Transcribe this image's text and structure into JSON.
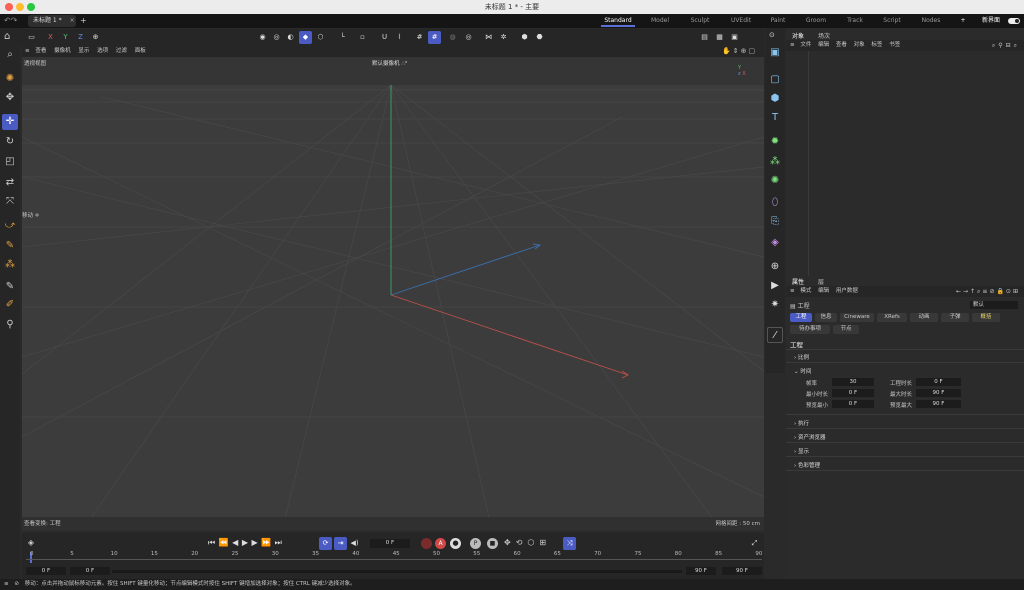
{
  "window": {
    "title": "未标题 1 * - 主要"
  },
  "doc_tab": {
    "label": "未标题 1 *",
    "close": "×",
    "add": "+"
  },
  "layouts": [
    "Standard",
    "Model",
    "Sculpt",
    "UVEdit",
    "Paint",
    "Groom",
    "Track",
    "Script",
    "Nodes"
  ],
  "layout_add": "+",
  "new_ui_label": "新界面",
  "axis_lock": {
    "x": "X",
    "y": "Y",
    "z": "Z"
  },
  "viewport_menu": [
    "查看",
    "摄像机",
    "显示",
    "选项",
    "过滤",
    "面板"
  ],
  "viewport": {
    "name": "透视视图",
    "camera": "默认摄像机",
    "camera_icon": "∴°",
    "move_label": "移动",
    "bottom_left": "查看变换: 工程",
    "bottom_right": "网格间距 : 50 cm"
  },
  "timeline": {
    "current_frame": "0 F",
    "ticks": [
      "0",
      "5",
      "10",
      "15",
      "20",
      "25",
      "30",
      "35",
      "40",
      "45",
      "50",
      "55",
      "60",
      "65",
      "70",
      "75",
      "80",
      "85",
      "90"
    ],
    "start": "0 F",
    "preview_start": "0 F",
    "preview_end": "90 F",
    "end": "90 F"
  },
  "object_panel": {
    "tabs": [
      "对象",
      "场次"
    ],
    "menu": [
      "文件",
      "编辑",
      "查看",
      "对象",
      "标签",
      "书签"
    ]
  },
  "attr_panel": {
    "tabs": [
      "属性",
      "层"
    ],
    "menu": [
      "模式",
      "编辑",
      "用户数据"
    ],
    "object_label": "工程",
    "preset_value": "默认",
    "chips": [
      "工程",
      "信息",
      "Cineware",
      "XRefs",
      "动画",
      "子弹",
      "概括",
      "待办事项",
      "节点"
    ],
    "section_title": "工程",
    "groups": [
      "比例",
      "时间",
      "执行",
      "资产浏览器",
      "显示",
      "色彩管理"
    ],
    "fields": {
      "fps_label": "帧率",
      "fps_value": "30",
      "project_time_label": "工程时长",
      "project_time_value": "0 F",
      "min_time_label": "最小时长",
      "min_time_value": "0 F",
      "max_time_label": "最大时长",
      "max_time_value": "90 F",
      "preview_min_label": "预览最小",
      "preview_min_value": "0 F",
      "preview_max_label": "预览最大",
      "preview_max_value": "90 F"
    }
  },
  "status": {
    "text": "移动：点击并拖动鼠标移动元素。按住 SHIFT 键量化移动；节点编辑模式时按住 SHIFT 键增加选择对象；按住 CTRL 键减少选择对象。"
  },
  "colors": {
    "accent": "#4a5bc4",
    "axis_x": "#c0504a",
    "axis_y": "#3fa46a",
    "axis_z": "#3c6fb0"
  }
}
